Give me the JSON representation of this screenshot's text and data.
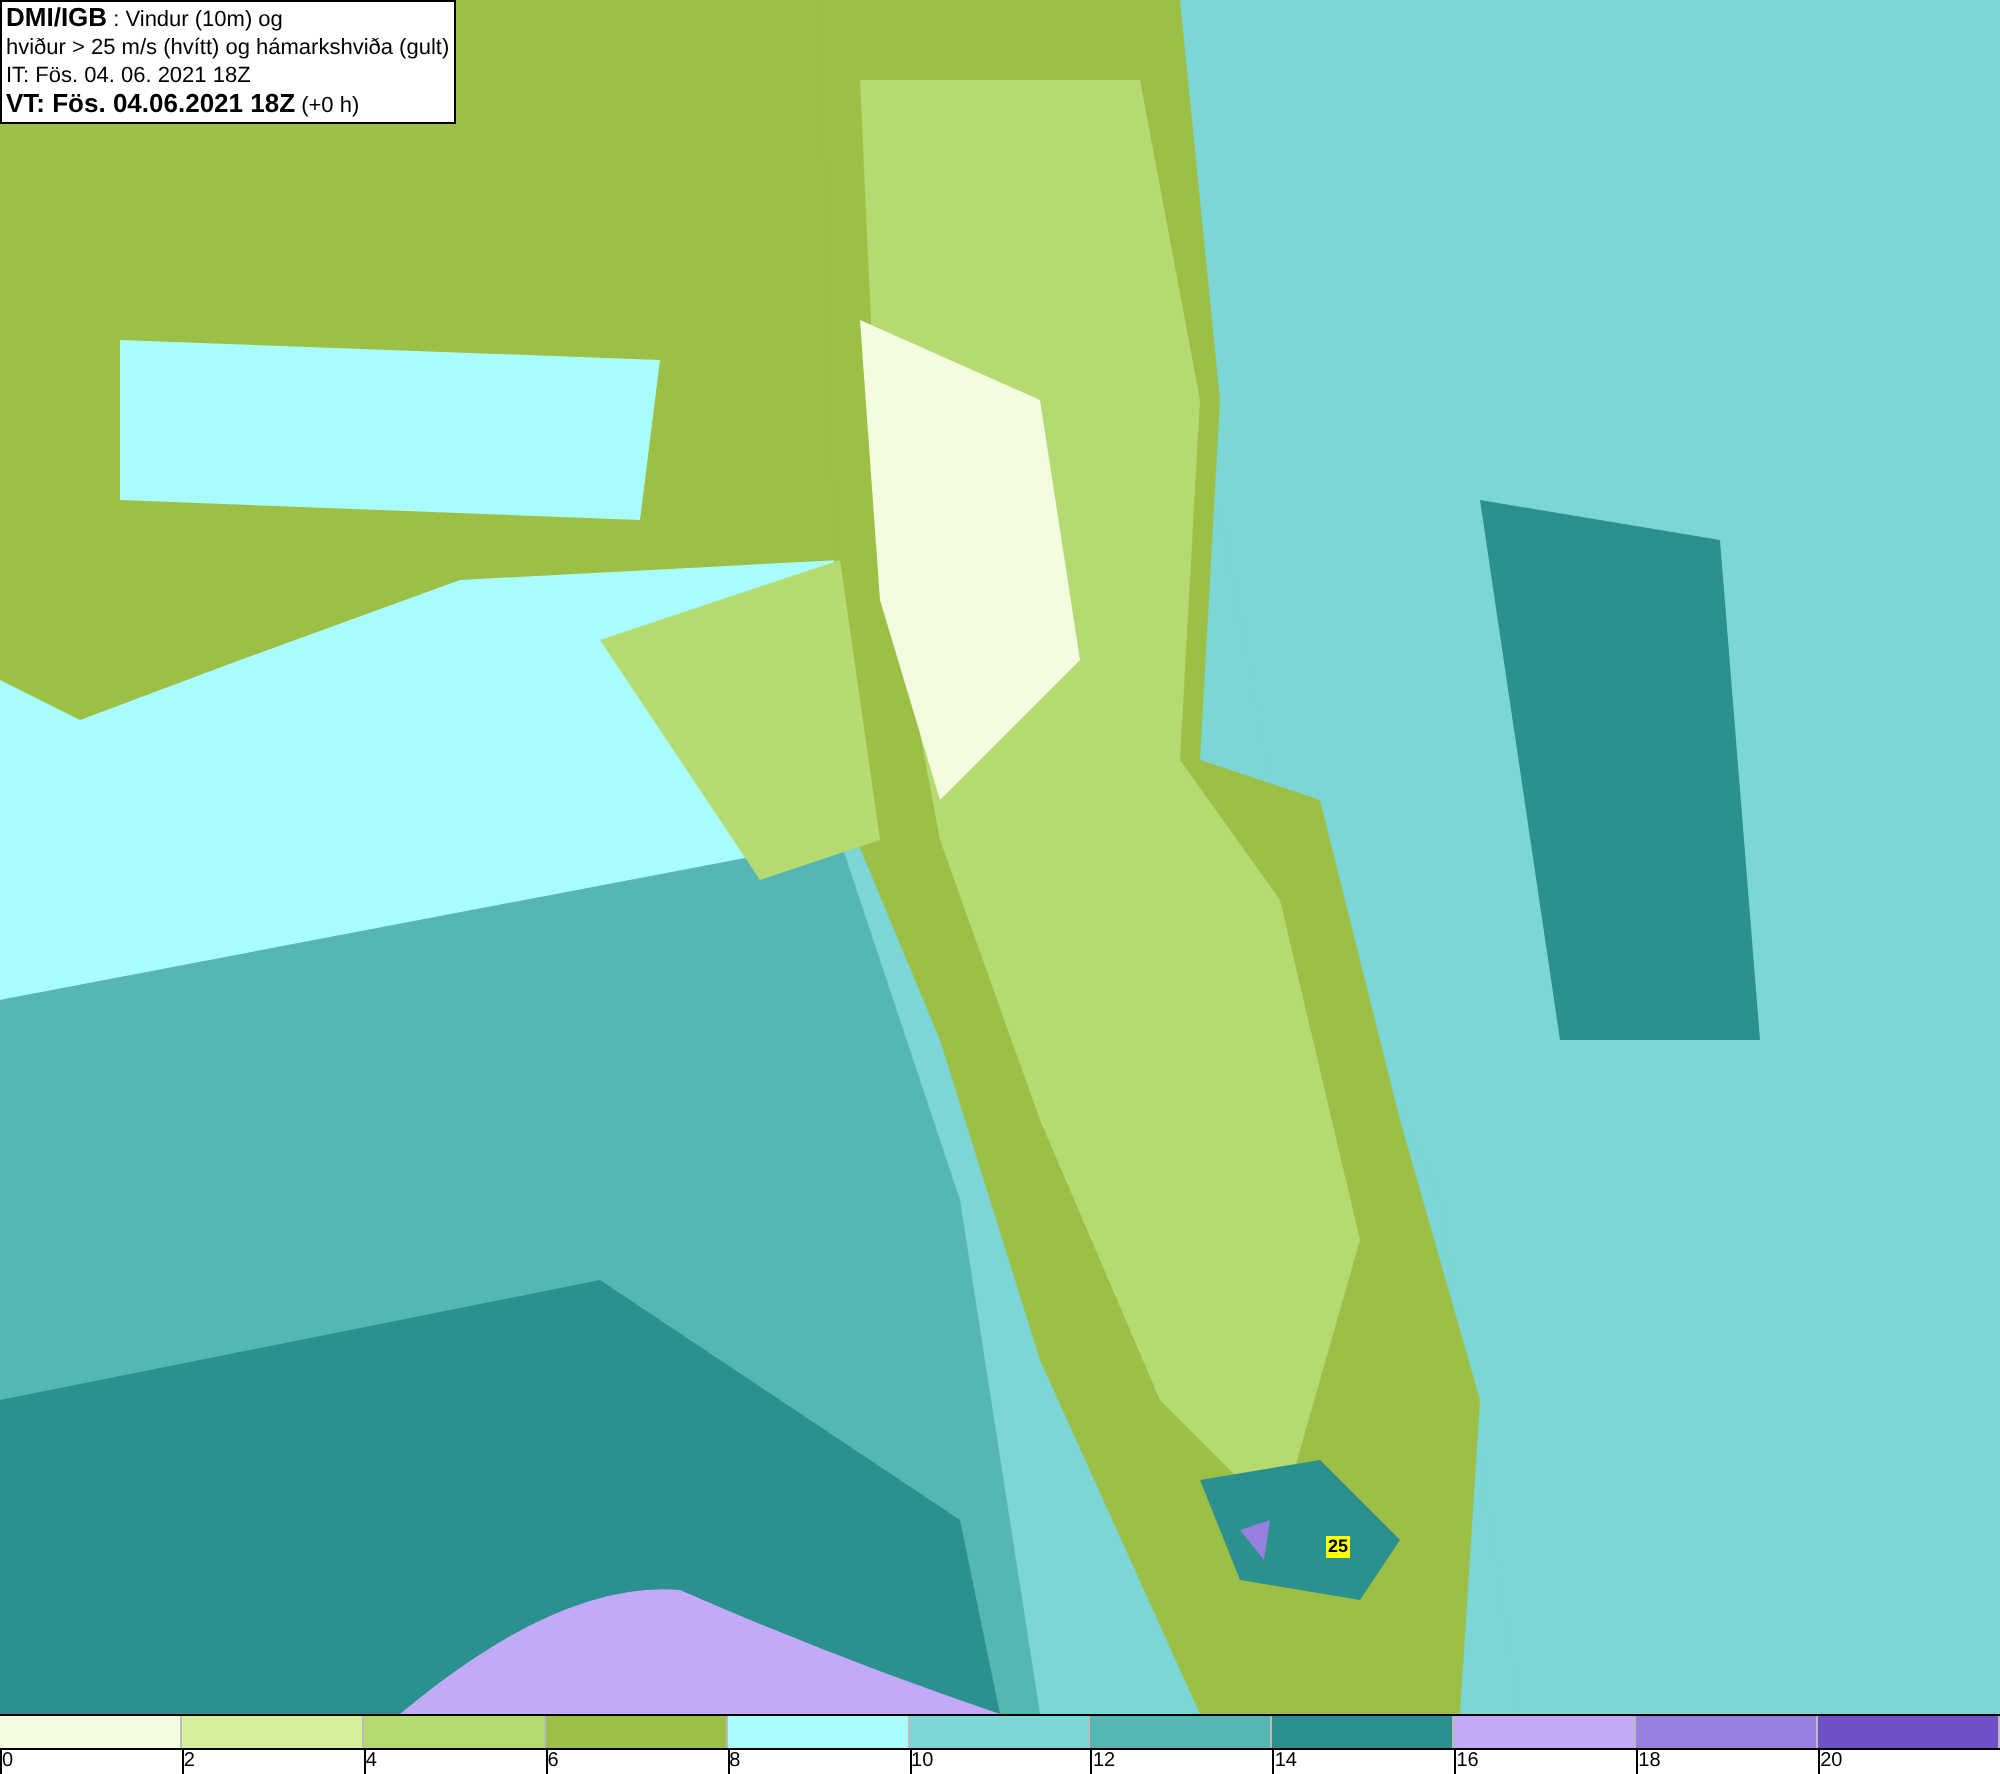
{
  "header": {
    "lines": [
      "**DMI/IGB** : Vindur (10m) og",
      "hviður > 25 m/s (hvítt) og hámarkshviða (gult)",
      "IT: Fös. 04. 06. 2021 18Z",
      "**VT: Fös. 04.06.2021 18Z** (+0 h)"
    ]
  },
  "map": {
    "gust_marker": "25"
  },
  "legend": {
    "bins": [
      {
        "color": "#f4fce0",
        "label": "0"
      },
      {
        "color": "#d6f09a",
        "label": "2"
      },
      {
        "color": "#b6da72",
        "label": "4"
      },
      {
        "color": "#9cbf46",
        "label": "6"
      },
      {
        "color": "#a8fcfc",
        "label": "8"
      },
      {
        "color": "#7cd6d6",
        "label": "10"
      },
      {
        "color": "#56b6b4",
        "label": "12"
      },
      {
        "color": "#2a918e",
        "label": "14"
      },
      {
        "color": "#c2aaf8",
        "label": "16"
      },
      {
        "color": "#9880e0",
        "label": "18"
      },
      {
        "color": "#7050c8",
        "label": "20"
      }
    ]
  }
}
